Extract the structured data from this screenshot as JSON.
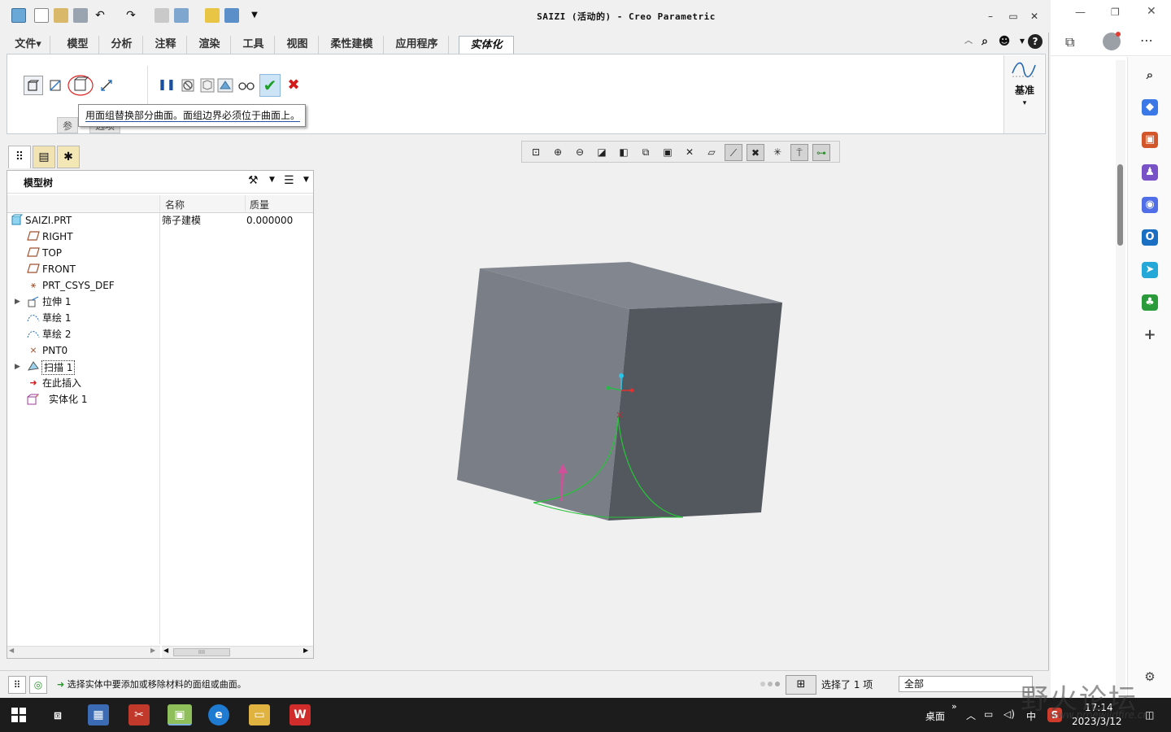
{
  "window": {
    "title": "SAIZI (活动的) - Creo Parametric",
    "minimize": "–",
    "restore": "▭",
    "close": "✕"
  },
  "menu": {
    "tabs": [
      "文件▾",
      "模型",
      "分析",
      "注释",
      "渲染",
      "工具",
      "视图",
      "柔性建模",
      "应用程序",
      "实体化"
    ]
  },
  "ribbon": {
    "tooltip": "用面组替换部分曲面。面组边界必须位于曲面上。",
    "subtab_1": "参",
    "subtab_2": "选项",
    "datum_label": "基准",
    "datum_arrow": "▾",
    "pause_label": "❚❚",
    "ok_label": "✔",
    "cancel_label": "✖"
  },
  "model_tree": {
    "title": "模型树",
    "columns": [
      "名称",
      "质量"
    ],
    "rows": [
      {
        "label": "SAIZI.PRT",
        "name": "筛子建模",
        "mass": "0.000000",
        "icon": "part-icon"
      },
      {
        "label": "RIGHT",
        "icon": "datum-plane-icon"
      },
      {
        "label": "TOP",
        "icon": "datum-plane-icon"
      },
      {
        "label": "FRONT",
        "icon": "datum-plane-icon"
      },
      {
        "label": "PRT_CSYS_DEF",
        "icon": "csys-icon"
      },
      {
        "label": "拉伸 1",
        "icon": "extrude-icon",
        "expandable": true
      },
      {
        "label": "草绘 1",
        "icon": "sketch-icon"
      },
      {
        "label": "草绘 2",
        "icon": "sketch-icon"
      },
      {
        "label": "PNT0",
        "icon": "datum-point-icon"
      },
      {
        "label": "扫描 1",
        "icon": "sweep-icon",
        "expandable": true
      },
      {
        "label": "在此插入",
        "icon": "insert-here-icon"
      },
      {
        "label": "实体化 1",
        "icon": "solidify-icon"
      }
    ],
    "scroll_grip": "IIII"
  },
  "status": {
    "message": "选择实体中要添加或移除材料的面组或曲面。",
    "selection": "选择了 1 项",
    "filter": "全部"
  },
  "taskbar": {
    "desktop": "桌面",
    "chevron": "»",
    "ime": "中",
    "time": "17:14",
    "date": "2023/3/12"
  },
  "watermark": {
    "main": "野火论坛",
    "url": "www.proewildfire.cn"
  },
  "colors": {
    "accent": "#2b579a",
    "cube_front": "#7a7f87",
    "cube_side": "#53575e",
    "curve": "#27c23a",
    "ok": "#1f9e2a",
    "cancel": "#d11b1b"
  }
}
